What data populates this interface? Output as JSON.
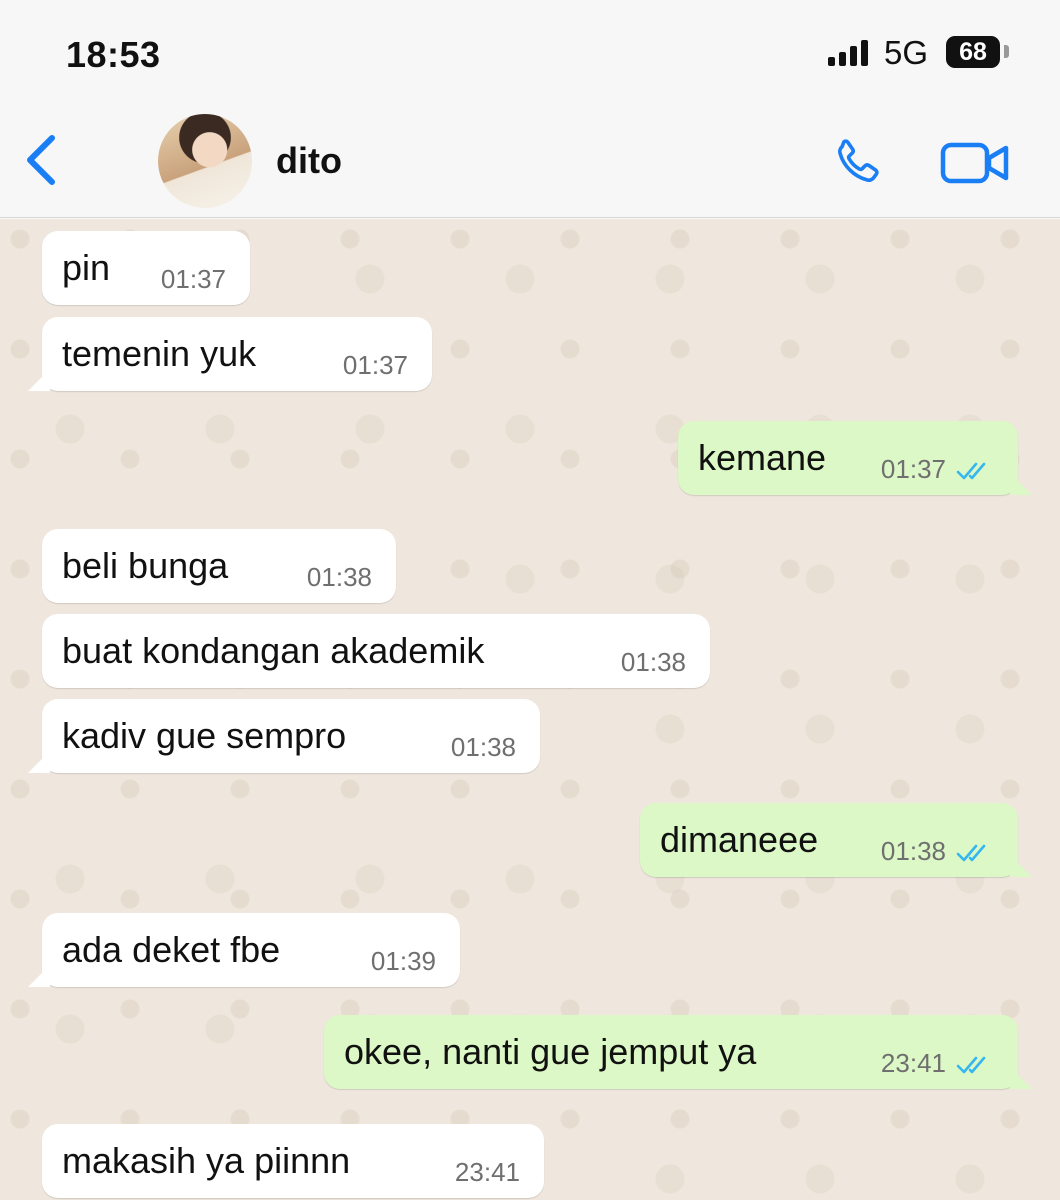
{
  "status_bar": {
    "time": "18:53",
    "network": "5G",
    "battery": "68"
  },
  "header": {
    "contact_name": "dito"
  },
  "messages": [
    {
      "direction": "in",
      "text": "pin",
      "time": "01:37"
    },
    {
      "direction": "in",
      "text": "temenin yuk",
      "time": "01:37"
    },
    {
      "direction": "out",
      "text": "kemane",
      "time": "01:37",
      "status": "read"
    },
    {
      "direction": "in",
      "text": "beli bunga",
      "time": "01:38"
    },
    {
      "direction": "in",
      "text": "buat kondangan akademik",
      "time": "01:38"
    },
    {
      "direction": "in",
      "text": "kadiv gue sempro",
      "time": "01:38"
    },
    {
      "direction": "out",
      "text": "dimaneee",
      "time": "01:38",
      "status": "read"
    },
    {
      "direction": "in",
      "text": "ada deket fbe",
      "time": "01:39"
    },
    {
      "direction": "out",
      "text": "okee, nanti gue jemput ya",
      "time": "23:41",
      "status": "read"
    },
    {
      "direction": "in",
      "text": "makasih ya piinnn",
      "time": "23:41"
    }
  ],
  "colors": {
    "accent_blue": "#1a7ef5",
    "read_ticks": "#34b7f1",
    "outgoing_bubble": "#dcf8c6",
    "incoming_bubble": "#ffffff",
    "chat_background": "#efe7dd"
  }
}
